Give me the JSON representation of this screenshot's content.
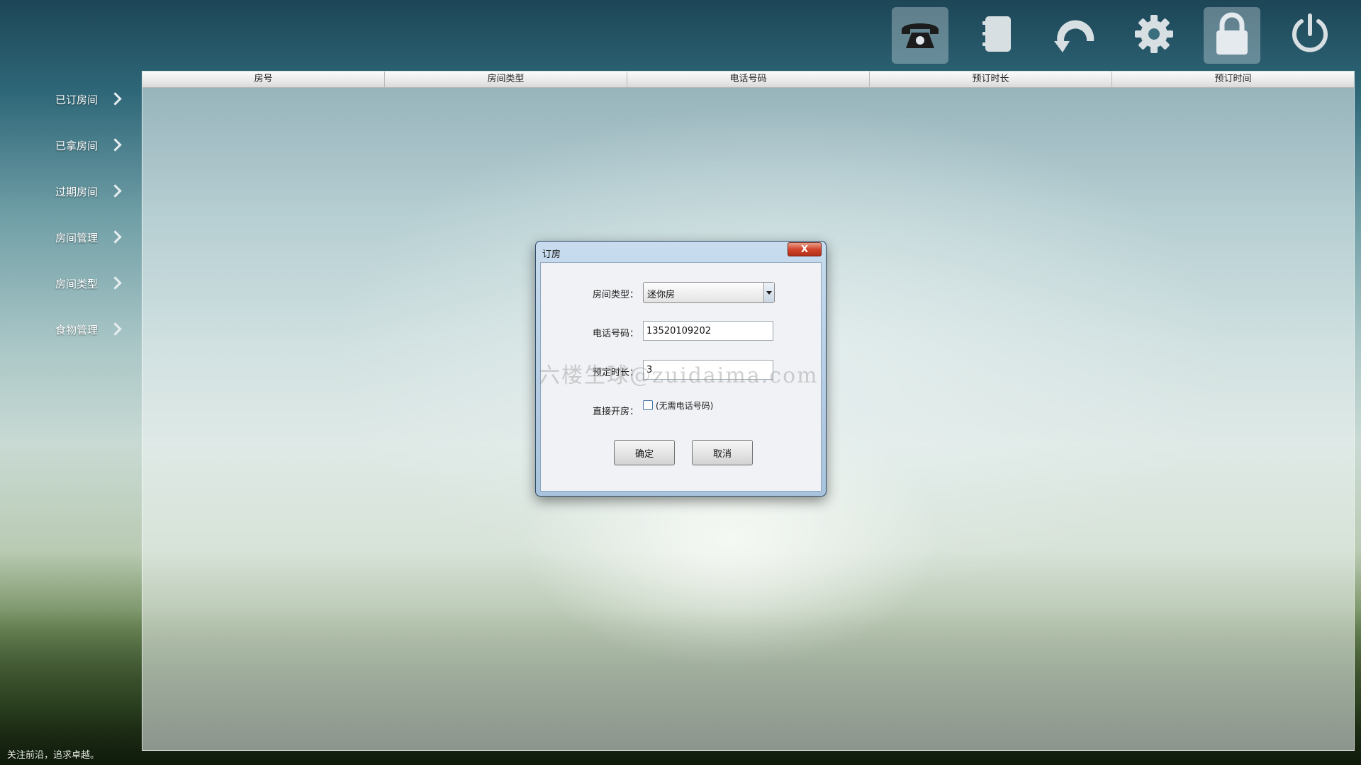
{
  "sidebar": {
    "items": [
      {
        "label": "已订房间"
      },
      {
        "label": "已拿房间"
      },
      {
        "label": "过期房间"
      },
      {
        "label": "房间管理"
      },
      {
        "label": "房间类型"
      },
      {
        "label": "食物管理"
      }
    ]
  },
  "toolbar": {
    "buttons": [
      {
        "icon": "telephone-icon",
        "active": true
      },
      {
        "icon": "notebook-icon",
        "active": false
      },
      {
        "icon": "refresh-icon",
        "active": false
      },
      {
        "icon": "gear-icon",
        "active": false
      },
      {
        "icon": "lock-icon",
        "active": true
      },
      {
        "icon": "power-icon",
        "active": false
      }
    ]
  },
  "table": {
    "headers": [
      "房号",
      "房间类型",
      "电话号码",
      "预订时长",
      "预订时间"
    ]
  },
  "dialog": {
    "title": "订房",
    "close_label": "X",
    "room_type_label": "房间类型：",
    "room_type_value": "迷你房",
    "phone_label": "电话号码：",
    "phone_value": "13520109202",
    "duration_label": "预定时长：",
    "duration_value": "3",
    "direct_label": "直接开房：",
    "direct_checkbox_label": "(无需电话号码)",
    "confirm_label": "确定",
    "cancel_label": "取消"
  },
  "watermark": "六楼生球@zuidaima.com",
  "footer": "关注前沿，追求卓越。",
  "colors": {
    "sidebar_text": "#ffffff",
    "dialog_frame": "#a8c3dc",
    "close_button": "#d2442a"
  }
}
